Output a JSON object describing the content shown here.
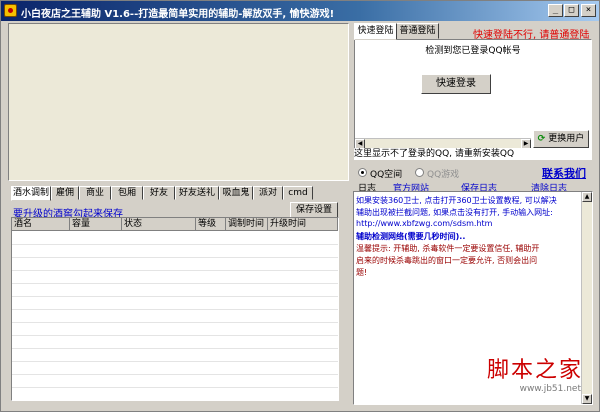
{
  "window": {
    "title": "小白夜店之王辅助 V1.6--打造最简单实用的辅助-解放双手, 愉快游戏!",
    "minimize": "_",
    "maximize": "□",
    "close": "×"
  },
  "login": {
    "tabs": [
      "快速登陆",
      "普通登陆"
    ],
    "warning": "快速登陆不行, 请普通登陆",
    "detect_text": "检测到您已登录QQ帐号",
    "quick_login_button": "快速登录",
    "switch_user_button": "更换用户",
    "notice": "这里显示不了登录的QQ, 请重新安装QQ"
  },
  "radios": {
    "qq_space": "QQ空间",
    "qq_game": "QQ游戏",
    "contact": "联系我们"
  },
  "log_tabs": {
    "log": "日志",
    "official_site": "官方网站",
    "save_log": "保存日志",
    "clear_log": "清除日志"
  },
  "log_lines": [
    {
      "text": "如果安装360卫士, 点击打开360卫士设置教程, 可以解决",
      "color": "#0000cc"
    },
    {
      "text": "辅助出现被拦截问题, 如果点击没有打开, 手动输入网址:",
      "color": "#0000cc"
    },
    {
      "text": "http://www.xbfzwg.com/sdsm.htm",
      "color": "#0000cc"
    },
    {
      "text": "辅助检测网络(需要几秒时间)..",
      "color": "#0000cc",
      "bold": true
    },
    {
      "text": "温馨提示: 开辅助, 杀毒软件一定要设置信任, 辅助开",
      "color": "#990000"
    },
    {
      "text": "启来的时候杀毒跳出的窗口一定要允许, 否则会出问",
      "color": "#990000"
    },
    {
      "text": "题!",
      "color": "#990000"
    }
  ],
  "lower_tabs": [
    "酒水调制",
    "雇佣",
    "商业",
    "包厢",
    "好友",
    "好友送礼",
    "吸血鬼",
    "派对",
    "cmd"
  ],
  "bar": {
    "upgrade_text": "要升级的酒窖勾起来保存",
    "save_settings": "保存设置"
  },
  "table": {
    "columns": [
      "酒名",
      "容量",
      "状态",
      "等级",
      "调制时间",
      "升级时间"
    ]
  },
  "watermark": {
    "title": "脚本之家",
    "url": "www.jb51.net"
  },
  "colors": {
    "accent_red": "#e00000",
    "link_blue": "#0000cc"
  }
}
